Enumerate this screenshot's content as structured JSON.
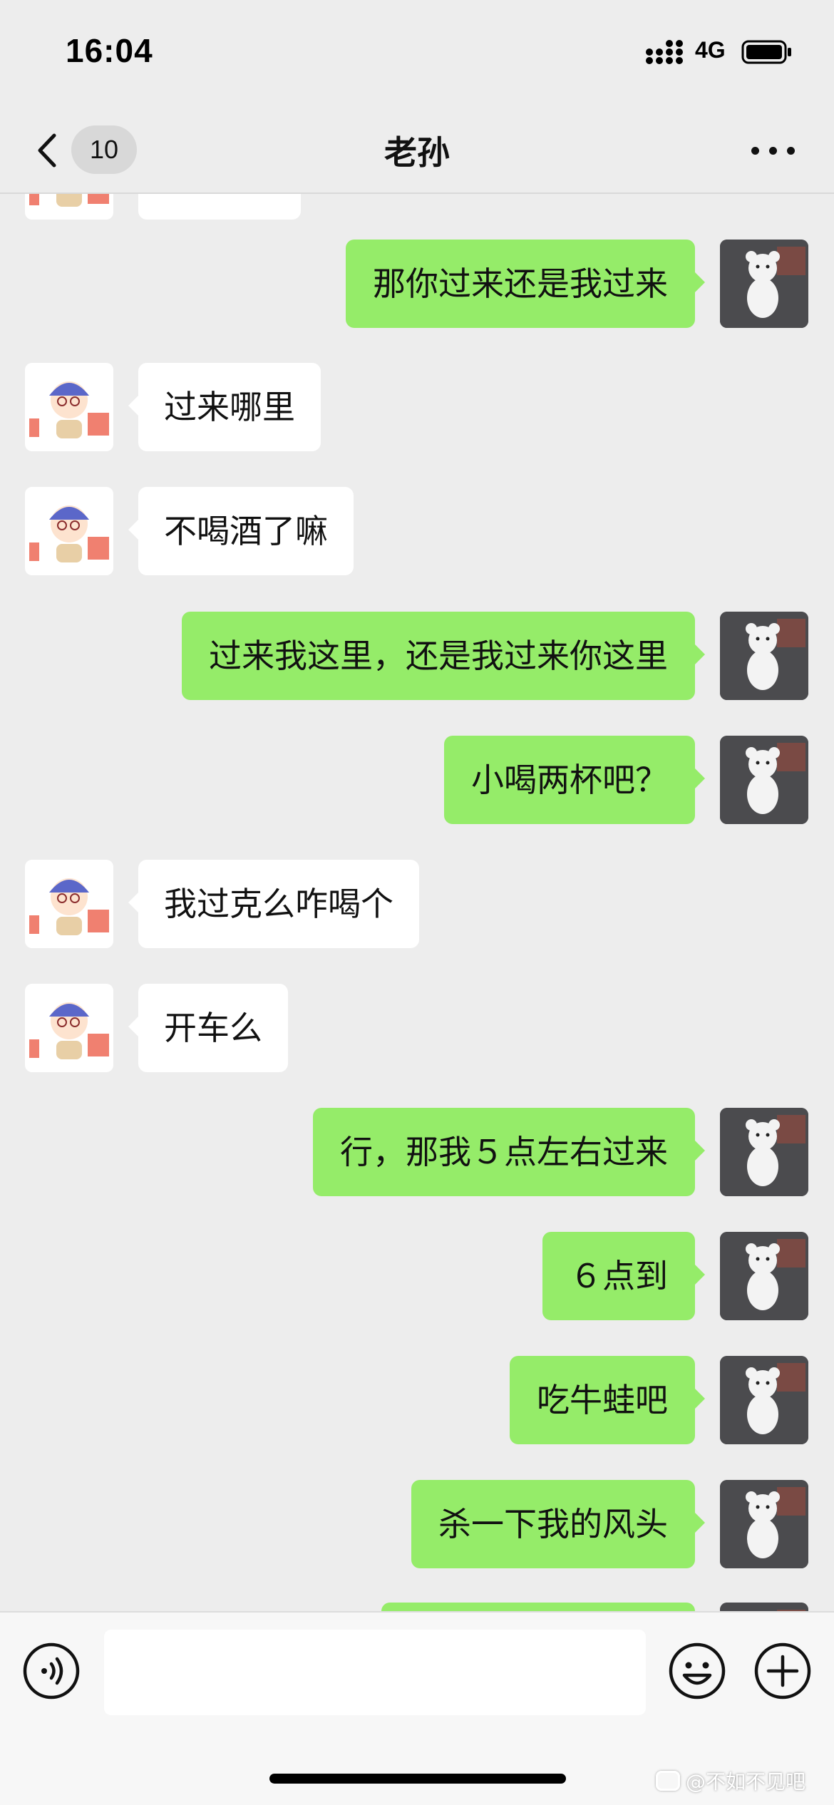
{
  "status_bar": {
    "time": "16:04",
    "network": "4G"
  },
  "header": {
    "unread_count": "10",
    "title": "老孙"
  },
  "colors": {
    "background": "#ededed",
    "outgoing_bubble": "#95ec69",
    "incoming_bubble": "#ffffff",
    "input_bar": "#f7f7f7"
  },
  "messages": [
    {
      "direction": "incoming",
      "text": ""
    },
    {
      "direction": "outgoing",
      "text": "那你过来还是我过来"
    },
    {
      "direction": "incoming",
      "text": "过来哪里"
    },
    {
      "direction": "incoming",
      "text": "不喝酒了嘛"
    },
    {
      "direction": "outgoing",
      "text": "过来我这里，还是我过来你这里"
    },
    {
      "direction": "outgoing",
      "text": "小喝两杯吧？"
    },
    {
      "direction": "incoming",
      "text": "我过克么咋喝个"
    },
    {
      "direction": "incoming",
      "text": "开车么"
    },
    {
      "direction": "outgoing",
      "text": "行，那我５点左右过来"
    },
    {
      "direction": "outgoing",
      "text": "６点到"
    },
    {
      "direction": "outgoing",
      "text": "吃牛蛙吧"
    },
    {
      "direction": "outgoing",
      "text": "杀一下我的风头"
    },
    {
      "direction": "outgoing",
      "text": ""
    }
  ],
  "avatars": {
    "incoming": "cartoon-boy-with-helmet-and-bricks-avatar",
    "outgoing": "white-teddy-bear-avatar"
  },
  "input_bar": {
    "message_value": "",
    "icons": [
      "voice-icon",
      "emoji-icon",
      "plus-icon"
    ]
  },
  "watermark": {
    "text": "@不如不见吧"
  }
}
